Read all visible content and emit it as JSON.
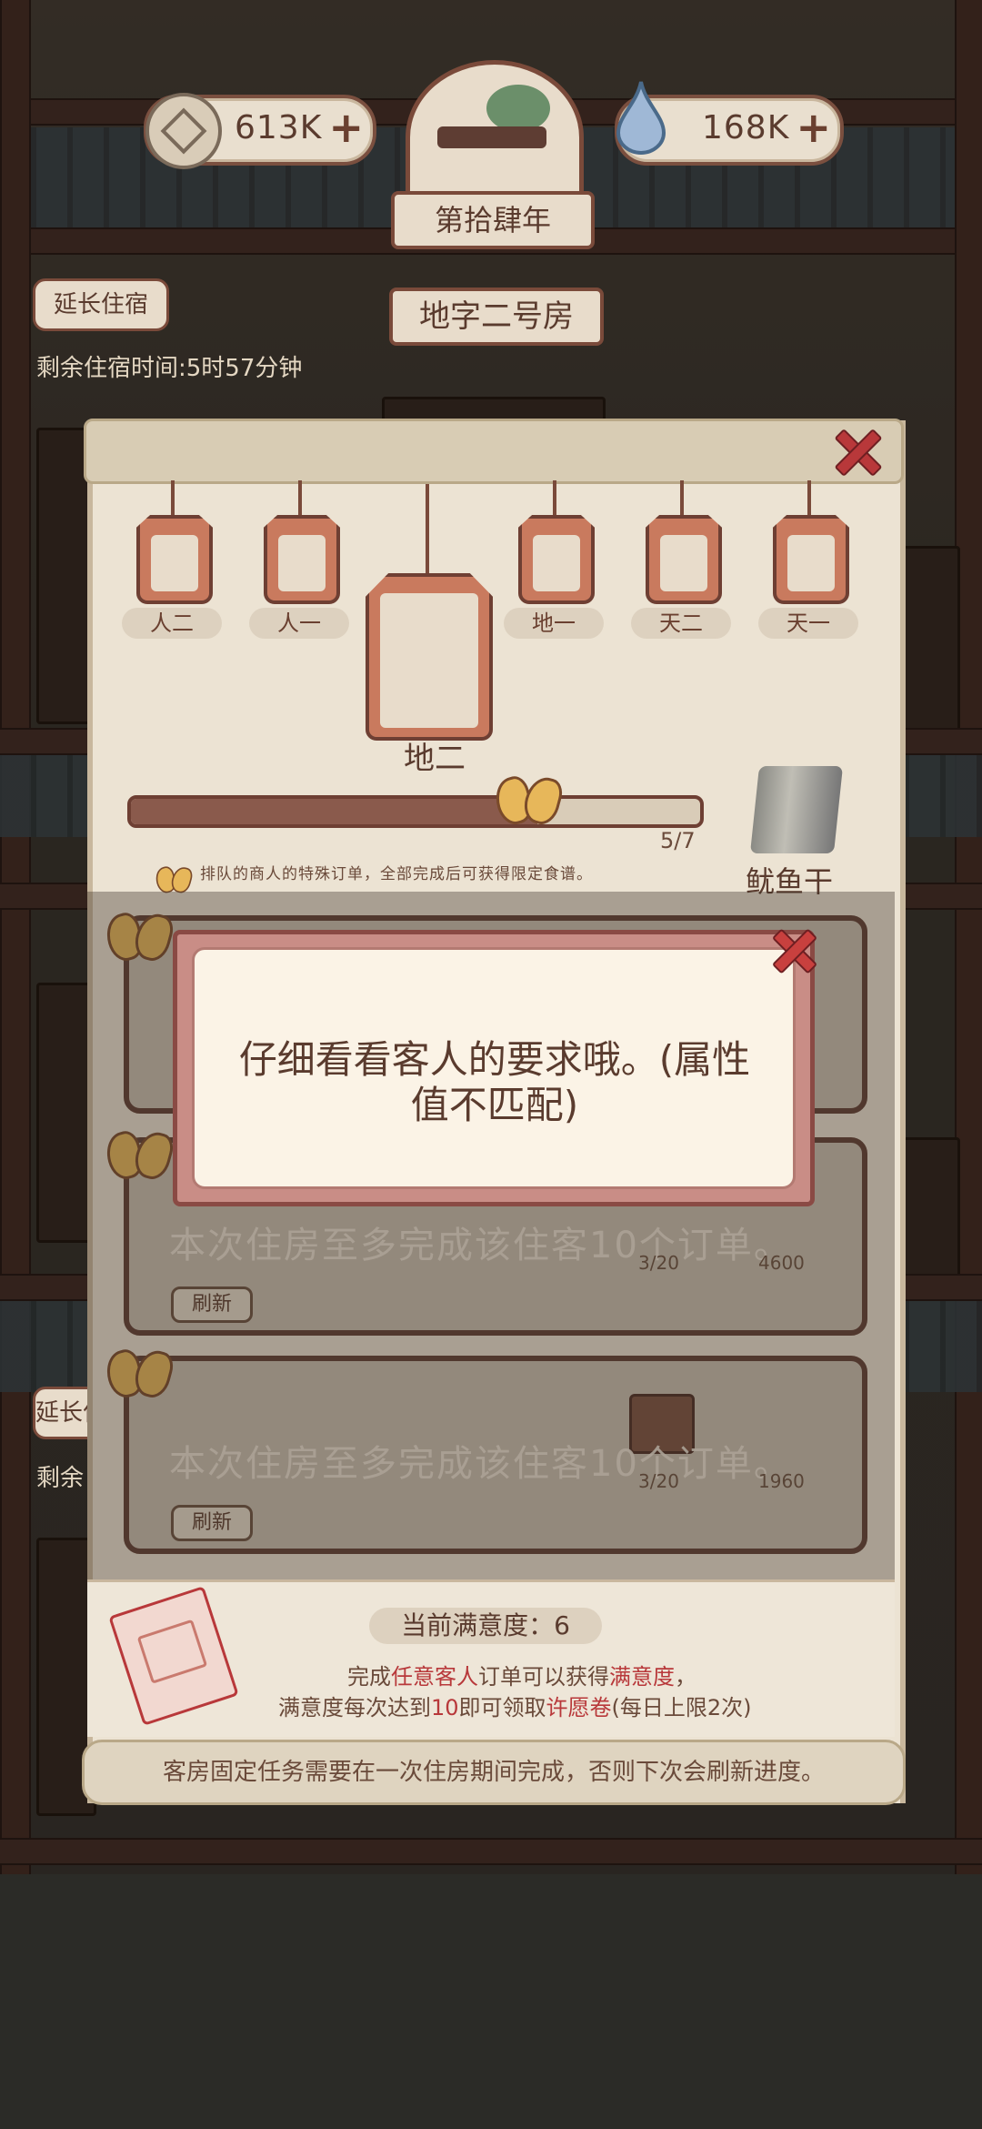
{
  "header": {
    "coins": "613K",
    "spirit": "168K",
    "year": "第拾肆年"
  },
  "room": {
    "extend_label": "延长住宿",
    "title": "地字二号房",
    "stay_time": "剩余住宿时间:5时57分钟",
    "extend_label_2": "延长住宿",
    "stay_time_2": "剩余"
  },
  "guests": {
    "tags": [
      {
        "label": "人二"
      },
      {
        "label": "人一"
      },
      {
        "label": "地二"
      },
      {
        "label": "地一"
      },
      {
        "label": "天二"
      },
      {
        "label": "天一"
      }
    ]
  },
  "progress": {
    "text": "5/7",
    "fraction": 0.714,
    "hint": "排队的商人的特殊订单，全部完成后可获得限定食谱。"
  },
  "reward_item": {
    "name": "鱿鱼干"
  },
  "orders": [
    {
      "text": "本次住房至多完成该住客10个订单。",
      "refresh": "刷新",
      "count": "3/20",
      "reward": "4600"
    },
    {
      "text": "本次住房至多完成该住客10个订单。",
      "refresh": "刷新",
      "count": "3/20",
      "reward": "1960"
    }
  ],
  "satisfaction": {
    "title": "当前满意度：6",
    "line1_a": "完成",
    "line1_b": "任意客人",
    "line1_c": "订单可以获得",
    "line1_d": "满意度",
    "line1_e": "，",
    "line2_a": "满意度每次达到",
    "line2_b": "10",
    "line2_c": "即可领取",
    "line2_d": "许愿卷",
    "line2_e": "(每日上限2次)"
  },
  "footer": {
    "text": "客房固定任务需要在一次住房期间完成，否则下次会刷新进度。"
  },
  "dialog": {
    "message": "仔细看看客人的要求哦。(属性值不匹配)"
  },
  "colors": {
    "accent_red": "#b8383a",
    "panel_bg": "#ece3d3",
    "wood": "#5e3d33"
  }
}
